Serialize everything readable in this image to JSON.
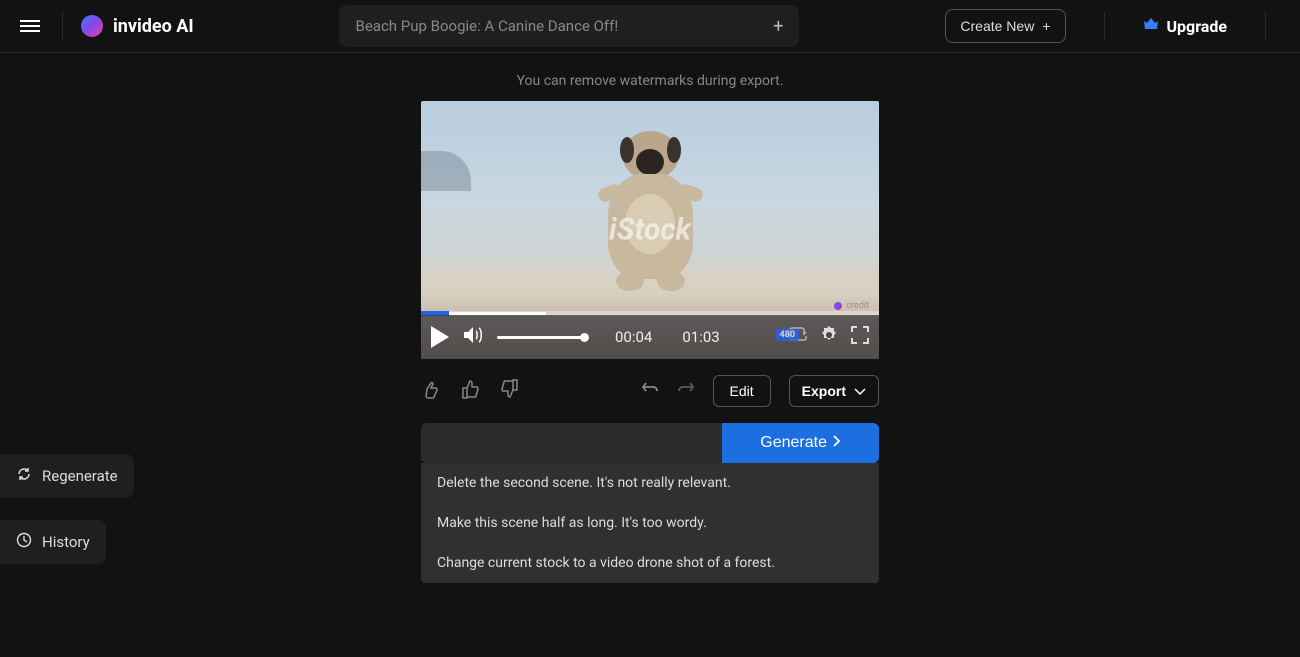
{
  "header": {
    "logo_text": "invideo AI",
    "project_title": "Beach Pup Boogie: A Canine Dance Off!",
    "create_new_label": "Create New",
    "upgrade_label": "Upgrade"
  },
  "notice": "You can remove watermarks during export.",
  "video": {
    "stock_watermark": "iStock",
    "current_time": "00:04",
    "total_time": "01:03",
    "quality_badge": "480"
  },
  "toolbar": {
    "edit_label": "Edit",
    "export_label": "Export"
  },
  "prompt": {
    "generate_label": "Generate"
  },
  "suggestions": [
    "Delete the second scene. It's not really relevant.",
    "Make this scene half as long. It's too wordy.",
    "Change current stock to a video drone shot of a forest."
  ],
  "side": {
    "regenerate_label": "Regenerate",
    "history_label": "History"
  }
}
